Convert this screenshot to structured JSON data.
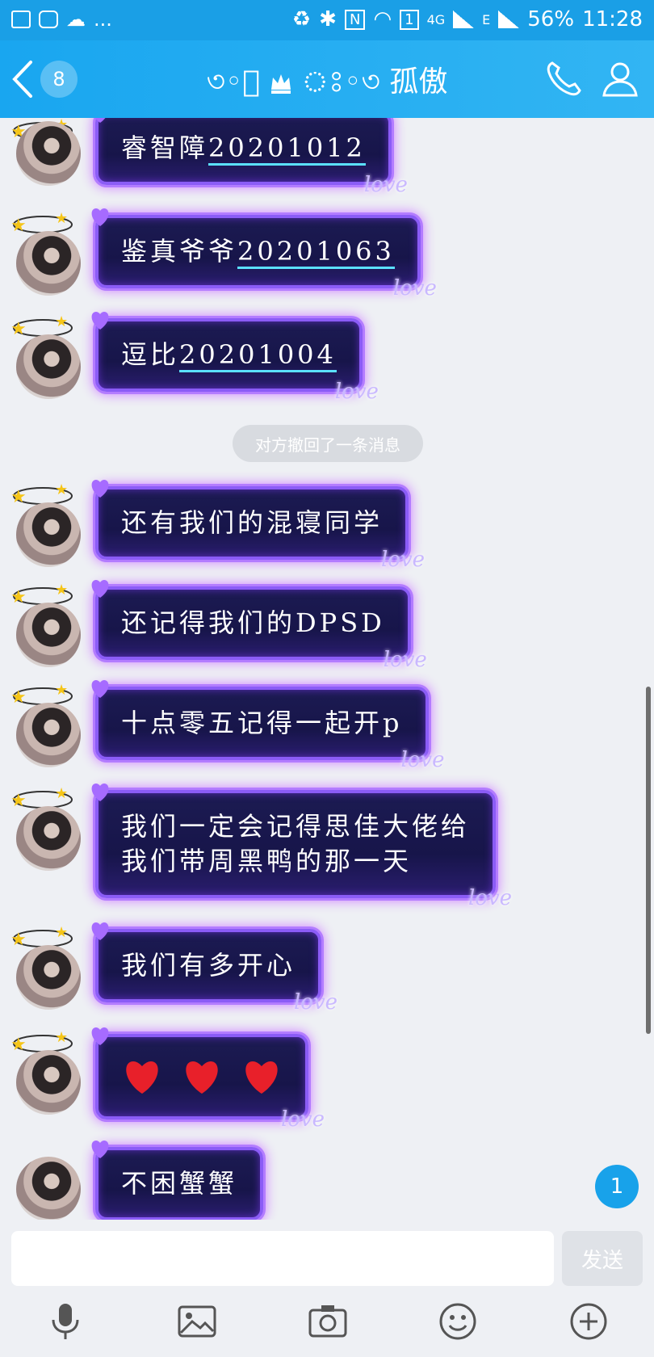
{
  "status_bar": {
    "icons_left": [
      "image-icon",
      "paw-icon",
      "cloud-icon"
    ],
    "more": "...",
    "battery": "56%",
    "time": "11:28",
    "net": "4G",
    "sim": "E",
    "wifi_badge": "1"
  },
  "nav": {
    "unread_count": "8",
    "title": "孤傲"
  },
  "messages": [
    {
      "text": "睿智障",
      "underline": "20201012"
    },
    {
      "text": "鉴真爷爷",
      "underline": "20201063"
    },
    {
      "text": "逗比",
      "underline": "20201004"
    },
    {
      "text": "还有我们的混寝同学"
    },
    {
      "text": "还记得我们的DPSD"
    },
    {
      "text": "十点零五记得一起开p"
    },
    {
      "text_line1": "我们一定会记得思佳大佬给",
      "text_line2": "我们带周黑鸭的那一天"
    },
    {
      "text": "我们有多开心"
    },
    {
      "hearts": 3
    },
    {
      "text": "不困蟹蟹"
    }
  ],
  "bubble_tag": "love",
  "notice": "对方撤回了一条消息",
  "unread_badge": "1",
  "input": {
    "value": "",
    "send_label": "发送"
  },
  "toolbar": [
    "microphone-icon",
    "image-icon",
    "camera-icon",
    "emoji-icon",
    "plus-icon"
  ],
  "colors": {
    "header": "#1a9fe6",
    "bubble_bg": "#1c1b52",
    "bubble_border": "#b37cff",
    "badge": "#18a2ea"
  }
}
